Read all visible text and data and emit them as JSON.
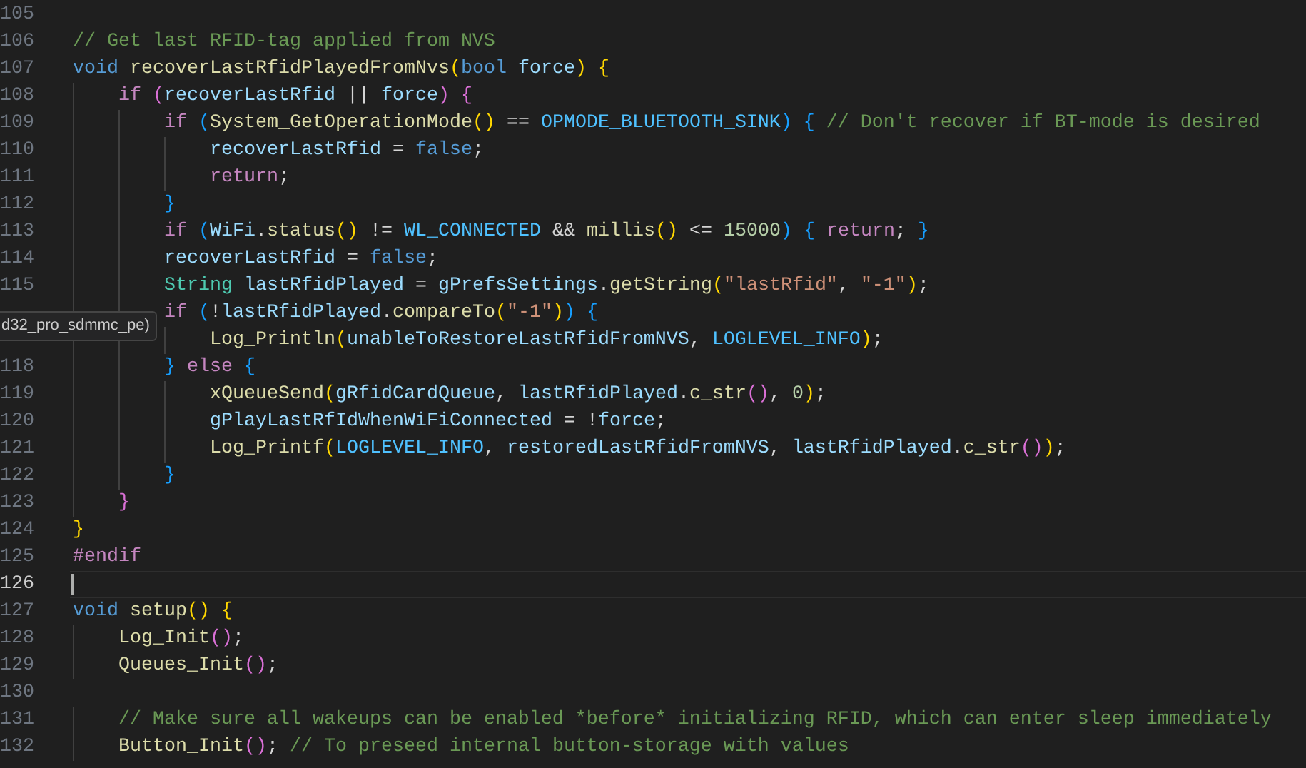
{
  "editor": {
    "lines": [
      {
        "number": "105",
        "current": false
      },
      {
        "number": "106",
        "current": false,
        "tokens": [
          {
            "kind": "comment",
            "text": "// Get last RFID-tag applied from NVS"
          }
        ]
      },
      {
        "number": "107",
        "current": false,
        "tokens": [
          {
            "kind": "keyword",
            "text": "void"
          },
          {
            "kind": "function",
            "text": " recoverLastRfidPlayedFromNvs"
          },
          {
            "kind": "bracket1",
            "text": "("
          },
          {
            "kind": "keyword",
            "text": "bool"
          },
          {
            "kind": "variable",
            "text": " force"
          },
          {
            "kind": "bracket1",
            "text": ")"
          },
          {
            "kind": "bracket1",
            "text": " {"
          }
        ]
      },
      {
        "number": "108",
        "current": false,
        "tokens": [
          {
            "kind": "control",
            "text": "    if"
          },
          {
            "kind": "bracket2",
            "text": " ("
          },
          {
            "kind": "variable",
            "text": "recoverLastRfid"
          },
          {
            "kind": "punct",
            "text": " || "
          },
          {
            "kind": "variable",
            "text": "force"
          },
          {
            "kind": "bracket2",
            "text": ")"
          },
          {
            "kind": "bracket2",
            "text": " {"
          }
        ]
      },
      {
        "number": "109",
        "current": false,
        "tokens": [
          {
            "kind": "control",
            "text": "        if"
          },
          {
            "kind": "bracket3",
            "text": " ("
          },
          {
            "kind": "function",
            "text": "System_GetOperationMode"
          },
          {
            "kind": "bracket1",
            "text": "()"
          },
          {
            "kind": "punct",
            "text": " == "
          },
          {
            "kind": "constant",
            "text": "OPMODE_BLUETOOTH_SINK"
          },
          {
            "kind": "bracket3",
            "text": ")"
          },
          {
            "kind": "bracket3",
            "text": " {"
          },
          {
            "kind": "comment",
            "text": " // Don't recover if BT-mode is desired"
          }
        ]
      },
      {
        "number": "110",
        "current": false,
        "tokens": [
          {
            "kind": "variable",
            "text": "            recoverLastRfid"
          },
          {
            "kind": "punct",
            "text": " = "
          },
          {
            "kind": "keyword",
            "text": "false"
          },
          {
            "kind": "punct",
            "text": ";"
          }
        ]
      },
      {
        "number": "111",
        "current": false,
        "tokens": [
          {
            "kind": "control",
            "text": "            return"
          },
          {
            "kind": "punct",
            "text": ";"
          }
        ]
      },
      {
        "number": "112",
        "current": false,
        "tokens": [
          {
            "kind": "bracket3",
            "text": "        }"
          }
        ]
      },
      {
        "number": "113",
        "current": false,
        "tokens": [
          {
            "kind": "control",
            "text": "        if"
          },
          {
            "kind": "bracket3",
            "text": " ("
          },
          {
            "kind": "variable",
            "text": "WiFi"
          },
          {
            "kind": "punct",
            "text": "."
          },
          {
            "kind": "function",
            "text": "status"
          },
          {
            "kind": "bracket1",
            "text": "()"
          },
          {
            "kind": "punct",
            "text": " != "
          },
          {
            "kind": "constant",
            "text": "WL_CONNECTED"
          },
          {
            "kind": "punct",
            "text": " && "
          },
          {
            "kind": "function",
            "text": "millis"
          },
          {
            "kind": "bracket1",
            "text": "()"
          },
          {
            "kind": "punct",
            "text": " <= "
          },
          {
            "kind": "number",
            "text": "15000"
          },
          {
            "kind": "bracket3",
            "text": ")"
          },
          {
            "kind": "bracket3",
            "text": " {"
          },
          {
            "kind": "control",
            "text": " return"
          },
          {
            "kind": "punct",
            "text": ";"
          },
          {
            "kind": "bracket3",
            "text": " }"
          }
        ]
      },
      {
        "number": "114",
        "current": false,
        "tokens": [
          {
            "kind": "variable",
            "text": "        recoverLastRfid"
          },
          {
            "kind": "punct",
            "text": " = "
          },
          {
            "kind": "keyword",
            "text": "false"
          },
          {
            "kind": "punct",
            "text": ";"
          }
        ]
      },
      {
        "number": "115",
        "current": false,
        "tokens": [
          {
            "kind": "type",
            "text": "        String"
          },
          {
            "kind": "variable",
            "text": " lastRfidPlayed"
          },
          {
            "kind": "punct",
            "text": " = "
          },
          {
            "kind": "variable",
            "text": "gPrefsSettings"
          },
          {
            "kind": "punct",
            "text": "."
          },
          {
            "kind": "function",
            "text": "getString"
          },
          {
            "kind": "bracket1",
            "text": "("
          },
          {
            "kind": "string",
            "text": "\"lastRfid\""
          },
          {
            "kind": "punct",
            "text": ", "
          },
          {
            "kind": "string",
            "text": "\"-1\""
          },
          {
            "kind": "bracket1",
            "text": ")"
          },
          {
            "kind": "punct",
            "text": ";"
          }
        ]
      },
      {
        "current": false,
        "tokens": [
          {
            "kind": "control",
            "text": "        if"
          },
          {
            "kind": "bracket3",
            "text": " ("
          },
          {
            "kind": "punct",
            "text": "!"
          },
          {
            "kind": "variable",
            "text": "lastRfidPlayed"
          },
          {
            "kind": "punct",
            "text": "."
          },
          {
            "kind": "function",
            "text": "compareTo"
          },
          {
            "kind": "bracket1",
            "text": "("
          },
          {
            "kind": "string",
            "text": "\"-1\""
          },
          {
            "kind": "bracket1",
            "text": ")"
          },
          {
            "kind": "bracket3",
            "text": ")"
          },
          {
            "kind": "bracket3",
            "text": " {"
          }
        ]
      },
      {
        "current": false,
        "tokens": [
          {
            "kind": "function",
            "text": "            Log_Println"
          },
          {
            "kind": "bracket1",
            "text": "("
          },
          {
            "kind": "variable",
            "text": "unableToRestoreLastRfidFromNVS"
          },
          {
            "kind": "punct",
            "text": ", "
          },
          {
            "kind": "constant",
            "text": "LOGLEVEL_INFO"
          },
          {
            "kind": "bracket1",
            "text": ")"
          },
          {
            "kind": "punct",
            "text": ";"
          }
        ]
      },
      {
        "number": "118",
        "current": false,
        "tokens": [
          {
            "kind": "bracket3",
            "text": "        }"
          },
          {
            "kind": "control",
            "text": " else"
          },
          {
            "kind": "bracket3",
            "text": " {"
          }
        ]
      },
      {
        "number": "119",
        "current": false,
        "tokens": [
          {
            "kind": "function",
            "text": "            xQueueSend"
          },
          {
            "kind": "bracket1",
            "text": "("
          },
          {
            "kind": "variable",
            "text": "gRfidCardQueue"
          },
          {
            "kind": "punct",
            "text": ", "
          },
          {
            "kind": "variable",
            "text": "lastRfidPlayed"
          },
          {
            "kind": "punct",
            "text": "."
          },
          {
            "kind": "function",
            "text": "c_str"
          },
          {
            "kind": "bracket2",
            "text": "()"
          },
          {
            "kind": "punct",
            "text": ", "
          },
          {
            "kind": "number",
            "text": "0"
          },
          {
            "kind": "bracket1",
            "text": ")"
          },
          {
            "kind": "punct",
            "text": ";"
          }
        ]
      },
      {
        "number": "120",
        "current": false,
        "tokens": [
          {
            "kind": "variable",
            "text": "            gPlayLastRfIdWhenWiFiConnected"
          },
          {
            "kind": "punct",
            "text": " = !"
          },
          {
            "kind": "variable",
            "text": "force"
          },
          {
            "kind": "punct",
            "text": ";"
          }
        ]
      },
      {
        "number": "121",
        "current": false,
        "tokens": [
          {
            "kind": "function",
            "text": "            Log_Printf"
          },
          {
            "kind": "bracket1",
            "text": "("
          },
          {
            "kind": "constant",
            "text": "LOGLEVEL_INFO"
          },
          {
            "kind": "punct",
            "text": ", "
          },
          {
            "kind": "variable",
            "text": "restoredLastRfidFromNVS"
          },
          {
            "kind": "punct",
            "text": ", "
          },
          {
            "kind": "variable",
            "text": "lastRfidPlayed"
          },
          {
            "kind": "punct",
            "text": "."
          },
          {
            "kind": "function",
            "text": "c_str"
          },
          {
            "kind": "bracket2",
            "text": "()"
          },
          {
            "kind": "bracket1",
            "text": ")"
          },
          {
            "kind": "punct",
            "text": ";"
          }
        ]
      },
      {
        "number": "122",
        "current": false,
        "tokens": [
          {
            "kind": "bracket3",
            "text": "        }"
          }
        ]
      },
      {
        "number": "123",
        "current": false,
        "tokens": [
          {
            "kind": "bracket2",
            "text": "    }"
          }
        ]
      },
      {
        "number": "124",
        "current": false,
        "tokens": [
          {
            "kind": "bracket1",
            "text": "}"
          }
        ]
      },
      {
        "number": "125",
        "current": false,
        "tokens": [
          {
            "kind": "preprocessor",
            "text": "#endif"
          }
        ]
      },
      {
        "number": "126",
        "current": true
      },
      {
        "number": "127",
        "current": false,
        "tokens": [
          {
            "kind": "keyword",
            "text": "void"
          },
          {
            "kind": "function",
            "text": " setup"
          },
          {
            "kind": "bracket1",
            "text": "()"
          },
          {
            "kind": "bracket1",
            "text": " {"
          }
        ]
      },
      {
        "number": "128",
        "current": false,
        "tokens": [
          {
            "kind": "function",
            "text": "    Log_Init"
          },
          {
            "kind": "bracket2",
            "text": "()"
          },
          {
            "kind": "punct",
            "text": ";"
          }
        ]
      },
      {
        "number": "129",
        "current": false,
        "tokens": [
          {
            "kind": "function",
            "text": "    Queues_Init"
          },
          {
            "kind": "bracket2",
            "text": "()"
          },
          {
            "kind": "punct",
            "text": ";"
          }
        ]
      },
      {
        "number": "130",
        "current": false
      },
      {
        "number": "131",
        "current": false,
        "tokens": [
          {
            "kind": "comment",
            "text": "    // Make sure all wakeups can be enabled *before* initializing RFID, which can enter sleep immediately"
          }
        ]
      },
      {
        "number": "132",
        "current": false,
        "tokens": [
          {
            "kind": "function",
            "text": "    Button_Init"
          },
          {
            "kind": "bracket2",
            "text": "()"
          },
          {
            "kind": "punct",
            "text": ";"
          },
          {
            "kind": "comment",
            "text": " // To preseed internal button-storage with values"
          }
        ]
      }
    ]
  },
  "tooltip": {
    "text": "d32_pro_sdmmc_pe)"
  }
}
